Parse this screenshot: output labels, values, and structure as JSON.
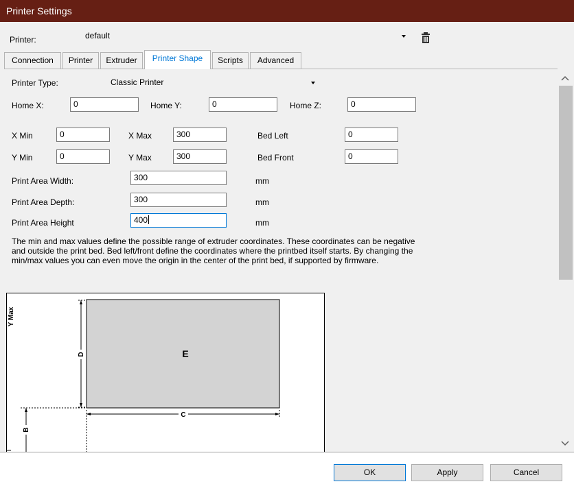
{
  "window": {
    "title": "Printer Settings"
  },
  "printer": {
    "label": "Printer:",
    "value": "default"
  },
  "tabs": [
    {
      "label": "Connection"
    },
    {
      "label": "Printer"
    },
    {
      "label": "Extruder"
    },
    {
      "label": "Printer Shape"
    },
    {
      "label": "Scripts"
    },
    {
      "label": "Advanced"
    }
  ],
  "form": {
    "printer_type_label": "Printer Type:",
    "printer_type_value": "Classic Printer",
    "home_x_label": "Home X:",
    "home_x": "0",
    "home_y_label": "Home Y:",
    "home_y": "0",
    "home_z_label": "Home Z:",
    "home_z": "0",
    "x_min_label": "X Min",
    "x_min": "0",
    "x_max_label": "X Max",
    "x_max": "300",
    "bed_left_label": "Bed Left",
    "bed_left": "0",
    "y_min_label": "Y Min",
    "y_min": "0",
    "y_max_label": "Y Max",
    "y_max": "300",
    "bed_front_label": "Bed Front",
    "bed_front": "0",
    "width_label": "Print Area Width:",
    "width": "300",
    "width_unit": "mm",
    "depth_label": "Print Area Depth:",
    "depth": "300",
    "depth_unit": "mm",
    "height_label": "Print Area Height",
    "height": "400",
    "height_unit": "mm"
  },
  "description": "The min and max values define the possible range of extruder coordinates. These coordinates can be negative and outside the print bed. Bed left/front define the coordinates where the printbed itself starts. By changing the min/max values you can even move the origin in the center of the print bed, if supported by firmware.",
  "diagram": {
    "y_max_label": "Y Max",
    "area_label": "E",
    "d_label": "D",
    "c_label": "C",
    "b_label": "B"
  },
  "buttons": {
    "ok": "OK",
    "apply": "Apply",
    "cancel": "Cancel"
  },
  "icons": {
    "delete": "trash-icon",
    "scroll_up": "chevron-up-icon",
    "scroll_down": "chevron-down-icon"
  },
  "colors": {
    "titlebar": "#661f14",
    "accent": "#0078d7"
  }
}
